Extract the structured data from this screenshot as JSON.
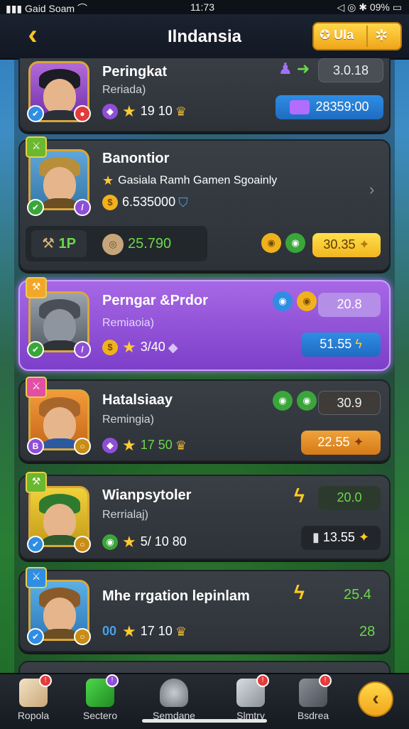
{
  "status": {
    "carrier": "Gaid Soam",
    "time": "11:73",
    "battery": "09%"
  },
  "header": {
    "title": "Ilndansia",
    "btn1": "Ula",
    "btn2": "☆",
    "back": "‹"
  },
  "cards": [
    {
      "name": "Peringkat",
      "sub": "Reriada)",
      "stat": "19 10",
      "pill1": "3.0.18",
      "pill2": "28359:00"
    },
    {
      "name": "Banontior",
      "sub": "Gasiala Ramh Gamen Sgoainly",
      "stat": "6.535000",
      "left_tag": "1P",
      "mid_val": "25.790",
      "pill2": "30.35"
    },
    {
      "name": "Perngar &Prdor",
      "sub": "Remiaoia)",
      "stat": "3/40",
      "pill1": "20.8",
      "pill2": "51.55"
    },
    {
      "name": "Hatalsiaay",
      "sub": "Remingia)",
      "stat": "17 50",
      "pill1": "30.9",
      "pill2": "22.55"
    },
    {
      "name": "Wianpsytoler",
      "sub": "Rerrialaj)",
      "stat": "5/ 10 80",
      "pill1": "20.0",
      "pill2": "13.55"
    },
    {
      "name": "Mhe rrgation lepinlam",
      "sub": "",
      "stat": "17 10",
      "coin_text": "00",
      "pill1": "25.4",
      "pill2": "28"
    }
  ],
  "nav": [
    {
      "label": "Ropola"
    },
    {
      "label": "Sectero"
    },
    {
      "label": "Semdane"
    },
    {
      "label": "Slmtry"
    },
    {
      "label": "Bsdrea"
    }
  ]
}
